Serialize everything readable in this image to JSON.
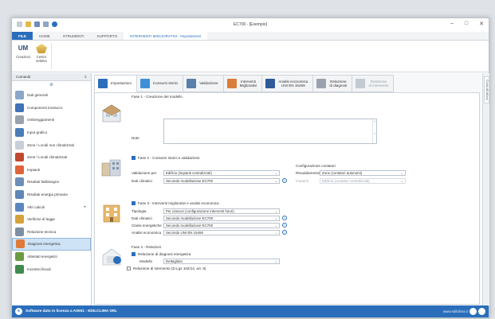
{
  "window": {
    "title": "EC700 - [Esempio]",
    "controls": [
      "–",
      "□",
      "✕"
    ]
  },
  "ribbon": {
    "tabs": [
      "FILE",
      "HOME",
      "STRUMENTI",
      "SUPPORTO",
      "INTERVENTI MIGLIORATIVI - Impostazioni"
    ],
    "buttons": [
      {
        "label": "Creazioni",
        "icon": "um-icon"
      },
      {
        "label": "Centro\nsettima",
        "icon": "center-icon"
      }
    ]
  },
  "sidebar": {
    "header": "Comandi",
    "pin": "⊕",
    "items": [
      {
        "label": "Dati generali",
        "color": "#8aa6c8"
      },
      {
        "label": "Componenti involucro",
        "color": "#3f72b6"
      },
      {
        "label": "Ombreggiamenti",
        "color": "#9aa3ad"
      },
      {
        "label": "Input grafico",
        "color": "#4a7db8"
      },
      {
        "label": "Zone / Locali non climatizzati",
        "color": "#c9cfd6"
      },
      {
        "label": "Zone / Locali climatizzati",
        "color": "#c0492f"
      },
      {
        "label": "Impianti",
        "color": "#e0623a"
      },
      {
        "label": "Risultati fabbisogno",
        "color": "#6d8fb7"
      },
      {
        "label": "Risultati energia primaria",
        "color": "#5f87b5"
      },
      {
        "label": "Altri calcoli",
        "color": "#5b86c1",
        "arrow": "▸"
      },
      {
        "label": "Verifiche di legge",
        "color": "#d6a23c"
      },
      {
        "label": "Relazione tecnica",
        "color": "#7f8fa3"
      },
      {
        "label": "Diagnosi energetica",
        "color": "#e07a3a",
        "selected": true
      },
      {
        "label": "Attestati energetici",
        "color": "#6a9b43"
      },
      {
        "label": "Incentivi fiscali",
        "color": "#3f8a4c"
      }
    ]
  },
  "tabs": [
    {
      "label": "Impostazioni",
      "color": "#2a6ebb",
      "active": true
    },
    {
      "label": "Consumi storici",
      "color": "#3f8fd8"
    },
    {
      "label": "Validazione",
      "color": "#5a7fa8"
    },
    {
      "label": "Interventi\nMigliorativi",
      "color": "#d97d3a"
    },
    {
      "label": "Analisi economica\nUNI EN 15459",
      "color": "#2d5b97"
    },
    {
      "label": "Relazione\ndi diagnosi",
      "color": "#9aa3ad"
    },
    {
      "label": "Relazione\ndi intervento",
      "color": "#c3cad1",
      "disabled": true
    }
  ],
  "phase1": {
    "title": "Fase 1 - Creazione del modello",
    "note_label": "Note",
    "note_value": ""
  },
  "phase2": {
    "title": "Fase 2 - Consumi storici e validazione",
    "checked": true,
    "rows": [
      {
        "label": "Validazione per",
        "value": "Edificio (impianti centralizzati)"
      },
      {
        "label": "Dati climatici",
        "value": "Secondo modellazione EC700"
      }
    ],
    "config": {
      "title": "Configurazione contatori",
      "rows": [
        {
          "label": "Riscaldamento",
          "value": "Zone (contatori autonomi)"
        },
        {
          "label": "Impianti",
          "value": "Edificio (contatori centralizzati)",
          "disabled": true
        }
      ]
    }
  },
  "phase3": {
    "title": "Fase 3 - Interventi migliorativi e analisi economica",
    "checked": true,
    "rows": [
      {
        "label": "Tipologia",
        "value": "Per ciascun (configurazione interventi futuri)"
      },
      {
        "label": "Dati climatici",
        "value": "Secondo modellazione EC700"
      },
      {
        "label": "Classi energetiche",
        "value": "Secondo modellazione EC700"
      },
      {
        "label": "Analisi economica",
        "value": "Secondo UNI EN 15459"
      }
    ]
  },
  "phase4": {
    "title": "Fase 4 - Relazioni",
    "rows": [
      {
        "label": "Relazione di diagnosi energetica",
        "checked": true
      },
      {
        "label": "Relazione di intervento (D.Lgs 102/14, art. 8)",
        "checked": false
      }
    ],
    "model_label": "Modello",
    "model_value": "Dettagliato"
  },
  "side_tab": "Guida all'utilizzo",
  "statusbar": {
    "text": "Software dato in licenza a A0001 - EDILCLIMA SRL",
    "site": "www.edilclima.it"
  }
}
